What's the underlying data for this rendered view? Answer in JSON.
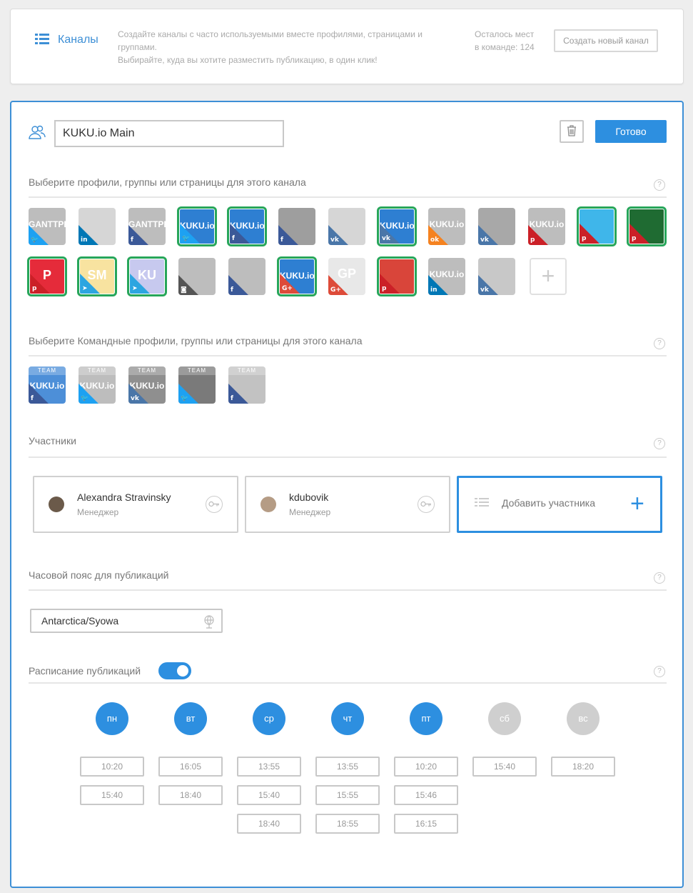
{
  "header": {
    "title": "Каналы",
    "description_line1": "Создайте каналы с часто используемыми вместе профилями, страницами и группами.",
    "description_line2": "Выбирайте, куда вы хотите разместить публикацию, в один клик!",
    "seats_line1": "Осталось мест",
    "seats_line2": "в команде: 124",
    "create_button": "Создать новый канал"
  },
  "channel": {
    "name": "KUKU.io Main",
    "done_button": "Готово"
  },
  "profiles_section": {
    "label": "Выберите профили, группы или страницы для этого канала",
    "help": "?",
    "add": "+",
    "tiles": [
      {
        "label": "GANTTPRO",
        "net": "tw",
        "bg": "#bdbdbd",
        "selected": false
      },
      {
        "label": "",
        "net": "in",
        "bg": "#d6d6d6",
        "selected": false
      },
      {
        "label": "GANTTPRO",
        "net": "f",
        "bg": "#bdbdbd",
        "selected": false
      },
      {
        "label": "KUKU.io",
        "net": "tw",
        "bg": "#2e7fd2",
        "selected": true
      },
      {
        "label": "KUKU.io",
        "net": "f",
        "bg": "#2e7fd2",
        "selected": true
      },
      {
        "label": "",
        "net": "f",
        "bg": "#9e9e9e",
        "selected": false
      },
      {
        "label": "",
        "net": "vk",
        "bg": "#d6d6d6",
        "selected": false
      },
      {
        "label": "KUKU.io",
        "net": "vk",
        "bg": "#2e7fd2",
        "selected": true
      },
      {
        "label": "KUKU.io",
        "net": "ok",
        "bg": "#bdbdbd",
        "selected": false
      },
      {
        "label": "",
        "net": "vk",
        "bg": "#a8a8a8",
        "selected": false
      },
      {
        "label": "KUKU.io",
        "net": "p",
        "bg": "#bdbdbd",
        "selected": false
      },
      {
        "label": "",
        "net": "p",
        "bg": "#3fb6ea",
        "selected": true
      },
      {
        "label": "",
        "net": "p",
        "bg": "#1f6b32",
        "selected": true
      },
      {
        "label": "P",
        "net": "p",
        "bg": "#e52b3a",
        "selected": true
      },
      {
        "label": "SM",
        "net": "tg",
        "bg": "#f8e3a0",
        "selected": true
      },
      {
        "label": "KU",
        "net": "tg",
        "bg": "#c7c9ef",
        "selected": true
      },
      {
        "label": "",
        "net": "ig",
        "bg": "#bdbdbd",
        "selected": false
      },
      {
        "label": "",
        "net": "f",
        "bg": "#bdbdbd",
        "selected": false
      },
      {
        "label": "KUKU.io",
        "net": "G+",
        "bg": "#2e7fd2",
        "selected": true
      },
      {
        "label": "GP",
        "net": "G+",
        "bg": "#e8e8e8",
        "selected": false
      },
      {
        "label": "",
        "net": "p",
        "bg": "#d9453a",
        "selected": true
      },
      {
        "label": "KUKU.io",
        "net": "in",
        "bg": "#bdbdbd",
        "selected": false
      },
      {
        "label": "",
        "net": "vk",
        "bg": "#c8c8c8",
        "selected": false
      }
    ]
  },
  "team_section": {
    "label": "Выберите Командные профили, группы или страницы для этого канала",
    "help": "?",
    "team_badge": "TEAM",
    "tiles": [
      {
        "label": "KUKU.io",
        "net": "f",
        "bg": "#4d8fd8"
      },
      {
        "label": "KUKU.io",
        "net": "tw",
        "bg": "#bdbdbd"
      },
      {
        "label": "KUKU.io",
        "net": "vk",
        "bg": "#8f8f8f"
      },
      {
        "label": "",
        "net": "tw",
        "bg": "#7a7a7a"
      },
      {
        "label": "",
        "net": "f",
        "bg": "#c2c2c2"
      }
    ]
  },
  "members_section": {
    "label": "Участники",
    "help": "?",
    "members": [
      {
        "name": "Alexandra Stravinsky",
        "role": "Менеджер"
      },
      {
        "name": "kdubovik",
        "role": "Менеджер"
      }
    ],
    "add_label": "Добавить участника",
    "add_icon": "+"
  },
  "timezone_section": {
    "label": "Часовой пояс для публикаций",
    "help": "?",
    "value": "Antarctica/Syowa"
  },
  "schedule_section": {
    "label": "Расписание публикаций",
    "help": "?",
    "enabled": true,
    "days": [
      {
        "label": "пн",
        "on": true,
        "times": [
          "10:20",
          "15:40"
        ]
      },
      {
        "label": "вт",
        "on": true,
        "times": [
          "16:05",
          "18:40"
        ]
      },
      {
        "label": "ср",
        "on": true,
        "times": [
          "13:55",
          "15:40",
          "18:40"
        ]
      },
      {
        "label": "чт",
        "on": true,
        "times": [
          "13:55",
          "15:55",
          "18:55"
        ]
      },
      {
        "label": "пт",
        "on": true,
        "times": [
          "10:20",
          "15:46",
          "16:15"
        ]
      },
      {
        "label": "сб",
        "on": false,
        "times": [
          "15:40"
        ]
      },
      {
        "label": "вс",
        "on": false,
        "times": [
          "18:20"
        ]
      }
    ]
  },
  "colors": {
    "accent": "#2d8fe0",
    "selected_outline": "#27a65a",
    "net": {
      "tw": "#1da1f2",
      "f": "#3b5998",
      "in": "#0077b5",
      "vk": "#4a76a8",
      "ok": "#f58220",
      "p": "#cb2027",
      "tg": "#2ca5e0",
      "ig": "#555555",
      "G+": "#dd4b39"
    }
  }
}
